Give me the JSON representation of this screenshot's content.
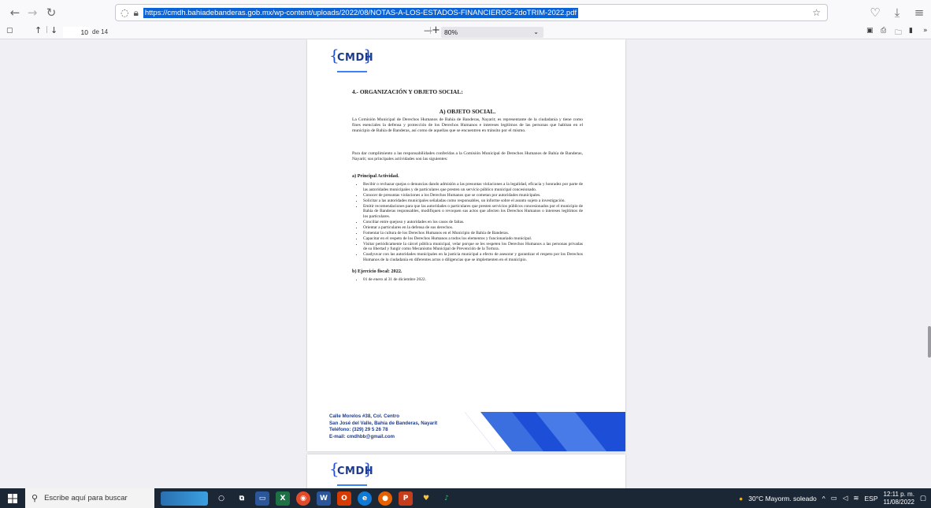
{
  "browser": {
    "url": "https://cmdh.bahiadebanderas.gob.mx/wp-content/uploads/2022/08/NOTAS-A-LOS-ESTADOS-FINANCIEROS-2doTRIM-2022.pdf"
  },
  "pdf_toolbar": {
    "page_number": "10",
    "page_total": "de 14",
    "zoom": "80%",
    "zoom_minus": "—",
    "zoom_plus": "+"
  },
  "document": {
    "logo_text": "CMDH",
    "section_heading": "4.- ORGANIZACIÓN Y OBJETO SOCIAL:",
    "subheading": "A) OBJETO SOCIAL.",
    "paragraph1": "La Comisión Municipal de Derechos Humanos de Bahía de Banderas, Nayarit; es representante de la ciudadanía y tiene como fines esenciales la defensa y protección de los Derechos Humanos e intereses legítimos de las personas que habitan en el municipio de Bahía de Banderas, así como de aquellas que se encuentren en tránsito por el mismo.",
    "paragraph2": "Para dar cumplimiento a las responsabilidades conferidas a la Comisión  Municipal de Derechos Humanos de Bahía de Banderas, Nayarit; sus principales actividades son las siguientes:",
    "principal_heading": "a) Principal Actividad.",
    "activities": [
      "Recibir o rechazar quejas o denuncias dando admisión a las presuntas violaciones a la legalidad, eficacia y honradez por parte de las autoridades municipales y de particulares que presten un servicio público municipal concesionado.",
      "Conocer de presuntas violaciones a los Derechos Humanos que se cometan por autoridades municipales.",
      "Solicitar a las autoridades municipales señaladas como responsables, un informe sobre el asunto sujeto a investigación.",
      "Emitir recomendaciones para que las autoridades o particulares que presten servicios públicos concesionados por el municipio de Bahía de Banderas responsables, modifiquen o revoquen sus actos que afecten los Derechos Humanos o intereses legítimos de los particulares.",
      "Conciliar entre quejoso y autoridades en los casos de faltas.",
      "Orientar a particulares en la defensa de sus derechos.",
      "Fomentar la cultura de los Derechos Humanos en el Municipio de Bahía de Banderas.",
      "Capacitar en el respeto de los Derechos Humanos a todos los elementos y funcionariado municipal.",
      "Visitar periódicamente la cárcel pública municipal, velar porque se les respeten los Derechos Humanos a las personas privadas de su libertad y fungir como Mecanismo Municipal de Prevención de la Tortura.",
      "Coadyuvar con las autoridades municipales en la justicia municipal a efecto de asesorar y garantizar el respeto por los Derechos Humanos de la ciudadanía en diferentes actos o diligencias que se implementen en el municipio."
    ],
    "fiscal_heading": "b) Ejercicio fiscal: 2022.",
    "fiscal_item": "01 de enero al 31 de diciembre 2022.",
    "footer": {
      "line1": "Calle Morelos #38, Col. Centro",
      "line2": "San José del Valle, Bahía de Banderas, Nayarit",
      "line3": "Teléfono: (329) 29 5 26 78",
      "line4": "E-mail: cmdhbb@gmail.com"
    }
  },
  "taskbar": {
    "search_placeholder": "Escribe aquí para buscar",
    "weather": "30°C  Mayorm. soleado",
    "lang": "ESP",
    "time": "12:11 p. m.",
    "date": "11/08/2022"
  },
  "colors": {
    "accent_blue": "#0a64d8",
    "footer_blue": "#1f3c8c",
    "taskbar": "#1c2735"
  }
}
